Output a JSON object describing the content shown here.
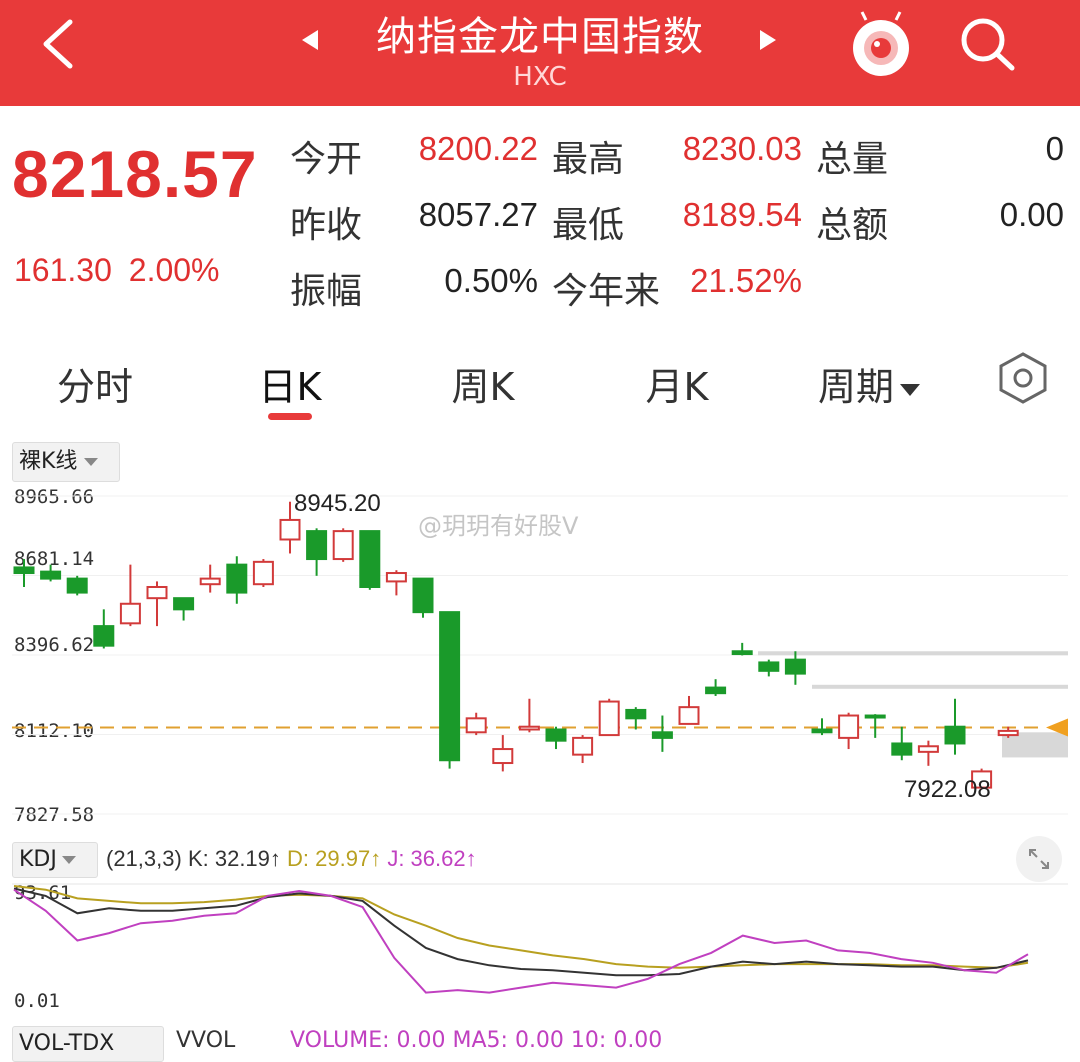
{
  "header": {
    "title": "纳指金龙中国指数",
    "code": "HXC",
    "back_icon": "chevron-left-icon",
    "prev_icon": "triangle-left-icon",
    "next_icon": "triangle-right-icon",
    "mascot_icon": "mascot-icon",
    "search_icon": "search-icon"
  },
  "quote": {
    "price": "8218.57",
    "change": "161.30",
    "change_pct": "2.00%",
    "stats": {
      "open_label": "今开",
      "open": "8200.22",
      "high_label": "最高",
      "high": "8230.03",
      "volume_label": "总量",
      "volume": "0",
      "prev_close_label": "昨收",
      "prev_close": "8057.27",
      "low_label": "最低",
      "low": "8189.54",
      "amount_label": "总额",
      "amount": "0.00",
      "amplitude_label": "振幅",
      "amplitude": "0.50%",
      "ytd_label": "今年来",
      "ytd": "21.52%"
    }
  },
  "tabs": [
    {
      "label": "分时"
    },
    {
      "label": "日K",
      "active": true
    },
    {
      "label": "周K"
    },
    {
      "label": "月K"
    },
    {
      "label": "周期"
    }
  ],
  "settings_icon": "hexagon-settings-icon",
  "chart": {
    "mode_label": "裸K线",
    "y_labels": [
      "8965.66",
      "8681.14",
      "8396.62",
      "8112.10",
      "7827.58"
    ],
    "high_annotation": "8945.20",
    "low_annotation": "7922.08",
    "watermark": "@玥玥有好股V",
    "ref_line_color": "#e0a030"
  },
  "chart_data": {
    "type": "candlestick",
    "ylim": [
      7827.58,
      8965.66
    ],
    "colors": {
      "up": "#d23a3a",
      "down": "#1a9a2a"
    },
    "candles": [
      {
        "o": 8710,
        "h": 8740,
        "l": 8640,
        "c": 8690
      },
      {
        "o": 8695,
        "h": 8720,
        "l": 8660,
        "c": 8670
      },
      {
        "o": 8670,
        "h": 8680,
        "l": 8610,
        "c": 8620
      },
      {
        "o": 8500,
        "h": 8560,
        "l": 8420,
        "c": 8430
      },
      {
        "o": 8510,
        "h": 8720,
        "l": 8500,
        "c": 8580
      },
      {
        "o": 8600,
        "h": 8660,
        "l": 8500,
        "c": 8640
      },
      {
        "o": 8600,
        "h": 8600,
        "l": 8520,
        "c": 8560
      },
      {
        "o": 8650,
        "h": 8720,
        "l": 8620,
        "c": 8670
      },
      {
        "o": 8720,
        "h": 8750,
        "l": 8580,
        "c": 8620
      },
      {
        "o": 8650,
        "h": 8740,
        "l": 8640,
        "c": 8730
      },
      {
        "o": 8810,
        "h": 8945.2,
        "l": 8760,
        "c": 8880
      },
      {
        "o": 8840,
        "h": 8850,
        "l": 8680,
        "c": 8740
      },
      {
        "o": 8740,
        "h": 8850,
        "l": 8730,
        "c": 8840
      },
      {
        "o": 8840,
        "h": 8840,
        "l": 8630,
        "c": 8640
      },
      {
        "o": 8660,
        "h": 8700,
        "l": 8610,
        "c": 8690
      },
      {
        "o": 8670,
        "h": 8670,
        "l": 8530,
        "c": 8550
      },
      {
        "o": 8550,
        "h": 8550,
        "l": 7990,
        "c": 8020
      },
      {
        "o": 8120,
        "h": 8190,
        "l": 8110,
        "c": 8170
      },
      {
        "o": 8010,
        "h": 8110,
        "l": 7980,
        "c": 8060
      },
      {
        "o": 8130,
        "h": 8240,
        "l": 8120,
        "c": 8140
      },
      {
        "o": 8130,
        "h": 8140,
        "l": 8060,
        "c": 8090
      },
      {
        "o": 8040,
        "h": 8110,
        "l": 8010,
        "c": 8100
      },
      {
        "o": 8110,
        "h": 8240,
        "l": 8110,
        "c": 8230
      },
      {
        "o": 8200,
        "h": 8210,
        "l": 8130,
        "c": 8170
      },
      {
        "o": 8120,
        "h": 8180,
        "l": 8050,
        "c": 8100
      },
      {
        "o": 8150,
        "h": 8250,
        "l": 8150,
        "c": 8210
      },
      {
        "o": 8280,
        "h": 8310,
        "l": 8250,
        "c": 8260
      },
      {
        "o": 8410,
        "h": 8440,
        "l": 8395,
        "c": 8400
      },
      {
        "o": 8370,
        "h": 8380,
        "l": 8320,
        "c": 8340
      },
      {
        "o": 8380,
        "h": 8410,
        "l": 8290,
        "c": 8330
      },
      {
        "o": 8130,
        "h": 8170,
        "l": 8110,
        "c": 8120
      },
      {
        "o": 8100,
        "h": 8190,
        "l": 8060,
        "c": 8180
      },
      {
        "o": 8180,
        "h": 8185,
        "l": 8100,
        "c": 8175
      },
      {
        "o": 8080,
        "h": 8140,
        "l": 8020,
        "c": 8040
      },
      {
        "o": 8050,
        "h": 8090,
        "l": 8000,
        "c": 8070
      },
      {
        "o": 8140,
        "h": 8240,
        "l": 8040,
        "c": 8080
      },
      {
        "o": 7922.08,
        "h": 7990,
        "l": 7922.08,
        "c": 7980
      },
      {
        "o": 8110,
        "h": 8140,
        "l": 8100,
        "c": 8125
      }
    ]
  },
  "kdj": {
    "selector_label": "KDJ",
    "params": "(21,3,3)",
    "k_label": "K: 32.19↑",
    "d_label": "D: 29.97↑",
    "j_label": "J: 36.62↑",
    "k_color": "#333333",
    "d_color": "#b8a020",
    "j_color": "#c040c0",
    "y_top": "93.61",
    "y_bottom": "0.01",
    "k": [
      90,
      84,
      70,
      74,
      72,
      72,
      74,
      76,
      83,
      86,
      84,
      80,
      60,
      42,
      33,
      28,
      25,
      24,
      22,
      20,
      20,
      21,
      27,
      31,
      29,
      31,
      29,
      28,
      27,
      27,
      24,
      26,
      32
    ],
    "d": [
      92,
      89,
      82,
      80,
      78,
      78,
      79,
      81,
      84,
      85,
      84,
      82,
      69,
      60,
      50,
      44,
      40,
      36,
      33,
      29,
      27,
      26,
      27,
      28,
      29,
      29,
      29,
      29,
      28,
      28,
      27,
      26,
      30
    ],
    "j": [
      89,
      72,
      48,
      54,
      62,
      64,
      68,
      70,
      84,
      88,
      84,
      75,
      34,
      6,
      8,
      6,
      10,
      14,
      12,
      10,
      17,
      29,
      38,
      52,
      46,
      48,
      40,
      38,
      33,
      30,
      24,
      22,
      37
    ],
    "expand_icon": "expand-icon"
  },
  "volume_row": {
    "selector_label": "VOL-TDX",
    "sub_label": "VVOL",
    "text": "VOLUME: 0.00 MA5: 0.00 10: 0.00"
  }
}
